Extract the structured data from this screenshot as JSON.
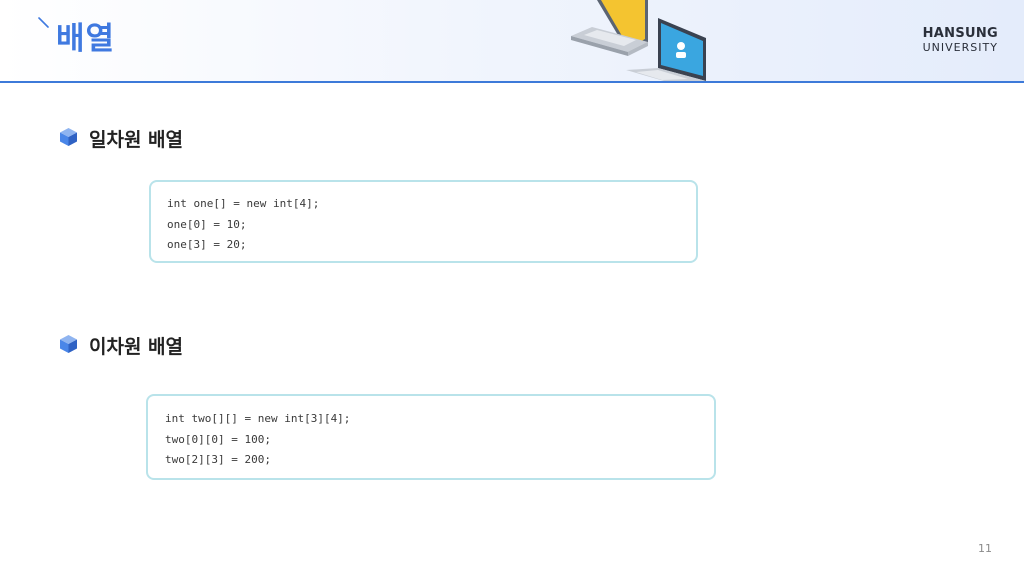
{
  "header": {
    "title": "배열",
    "logo": {
      "top": "HANSUNG",
      "bottom": "UNIVERSITY"
    }
  },
  "sections": [
    {
      "heading": "일차원 배열",
      "code": [
        "int one[] = new int[4];",
        "one[0] = 10;",
        "one[3] = 20;"
      ]
    },
    {
      "heading": "이차원 배열",
      "code": [
        "int two[][] = new int[3][4];",
        "two[0][0] = 100;",
        "two[2][3] = 200;"
      ]
    }
  ],
  "page_number": "11",
  "colors": {
    "accent": "#3f79e0",
    "header_rule": "#3d7ad9",
    "code_border": "#b9e3ea",
    "bullet": "#4a86e8"
  },
  "icons": [
    "slash-tick-icon",
    "laptops-illustration",
    "cube-bullet-icon"
  ]
}
